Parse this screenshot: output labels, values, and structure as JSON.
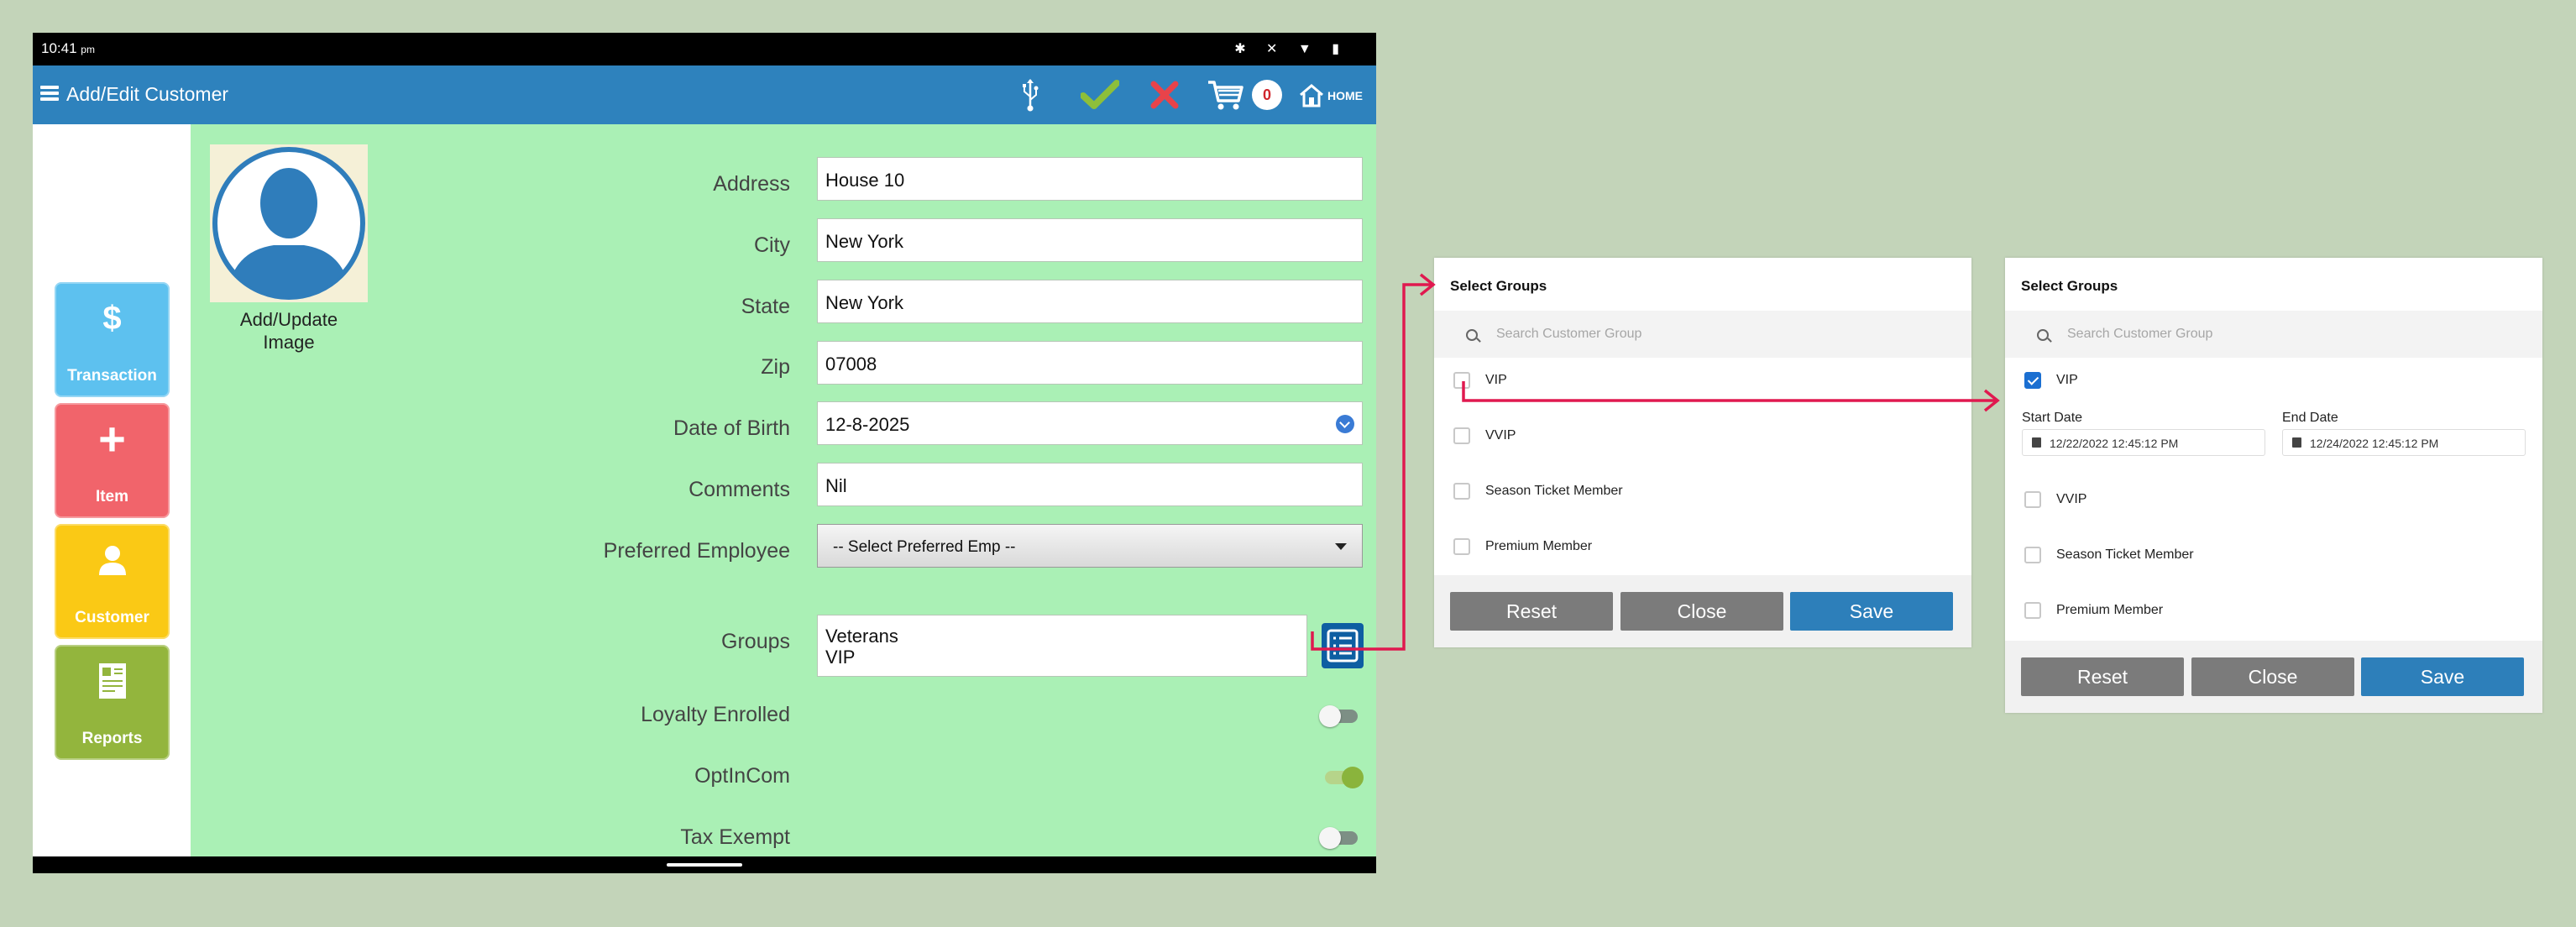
{
  "statusbar": {
    "time": "10:41",
    "ampm": "pm"
  },
  "appbar": {
    "title": "Add/Edit Customer",
    "cart_count": "0",
    "home_label": "HOME"
  },
  "sidebar": {
    "items": [
      {
        "label": "Transaction",
        "icon": "dollar-icon",
        "color": "#5dc1ef"
      },
      {
        "label": "Item",
        "icon": "plus-icon",
        "color": "#f1646b"
      },
      {
        "label": "Customer",
        "icon": "person-icon",
        "color": "#fac915"
      },
      {
        "label": "Reports",
        "icon": "report-icon",
        "color": "#93b53d"
      }
    ]
  },
  "avatar": {
    "label_line1": "Add/Update",
    "label_line2": "Image"
  },
  "form": {
    "address": {
      "label": "Address",
      "value": "House 10"
    },
    "city": {
      "label": "City",
      "value": "New York"
    },
    "state": {
      "label": "State",
      "value": "New York"
    },
    "zip": {
      "label": "Zip",
      "value": "07008"
    },
    "dob": {
      "label": "Date of Birth",
      "value": "12-8-2025"
    },
    "comments": {
      "label": "Comments",
      "value": "Nil"
    },
    "preferred_employee": {
      "label": "Preferred Employee",
      "value": "-- Select Preferred Emp --"
    },
    "groups": {
      "label": "Groups",
      "values": [
        "Veterans",
        "VIP"
      ]
    },
    "loyalty": {
      "label": "Loyalty Enrolled",
      "on": false
    },
    "optincom": {
      "label": "OptInCom",
      "on": true
    },
    "tax_exempt": {
      "label": "Tax Exempt",
      "on": false
    }
  },
  "dialog1": {
    "title": "Select Groups",
    "search_placeholder": "Search Customer Group",
    "options": [
      "VIP",
      "VVIP",
      "Season Ticket Member",
      "Premium Member"
    ],
    "checked": [
      false,
      false,
      false,
      false
    ],
    "buttons": {
      "reset": "Reset",
      "close": "Close",
      "save": "Save"
    }
  },
  "dialog2": {
    "title": "Select Groups",
    "search_placeholder": "Search Customer Group",
    "options": [
      "VIP",
      "VVIP",
      "Season Ticket Member",
      "Premium Member"
    ],
    "checked": [
      true,
      false,
      false,
      false
    ],
    "start_date_label": "Start Date",
    "start_date_value": "12/22/2022 12:45:12 PM",
    "end_date_label": "End Date",
    "end_date_value": "12/24/2022 12:45:12 PM",
    "buttons": {
      "reset": "Reset",
      "close": "Close",
      "save": "Save"
    }
  },
  "colors": {
    "appbar": "#2e82bd",
    "main_bg": "#aaf0b5",
    "arrow": "#e0194f",
    "save_blue": "#2d7fba"
  }
}
